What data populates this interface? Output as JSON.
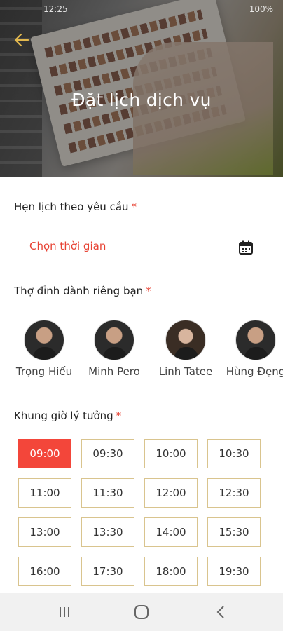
{
  "status_bar": {
    "left": "12:25",
    "right": "100%"
  },
  "header": {
    "title": "Đặt lịch dịch vụ",
    "back_icon": "arrow-left-icon"
  },
  "appointment": {
    "label": "Hẹn lịch theo yêu cầu",
    "required_mark": "*",
    "date_placeholder": "Chọn thời gian",
    "calendar_icon": "calendar-icon"
  },
  "stylists_section": {
    "label": "Thợ đỉnh dành riêng bạn",
    "required_mark": "*",
    "stylists": [
      {
        "name": "Trọng Hiếu"
      },
      {
        "name": "Minh Pero"
      },
      {
        "name": "Linh Tatee"
      },
      {
        "name": "Hùng Đẹng"
      }
    ]
  },
  "time_section": {
    "label": "Khung giờ lý tưởng",
    "required_mark": "*",
    "slots": [
      "09:00",
      "09:30",
      "10:00",
      "10:30",
      "11:00",
      "11:30",
      "12:00",
      "12:30",
      "13:00",
      "13:30",
      "14:00",
      "15:30",
      "16:00",
      "17:30",
      "18:00",
      "19:30"
    ],
    "selected": "09:00"
  },
  "colors": {
    "accent": "#f3463a",
    "gold": "#e2b84e",
    "border": "#d9c48e"
  },
  "nav": {
    "recents_icon": "recents-icon",
    "home_icon": "home-icon",
    "back_icon": "back-chevron-icon"
  }
}
